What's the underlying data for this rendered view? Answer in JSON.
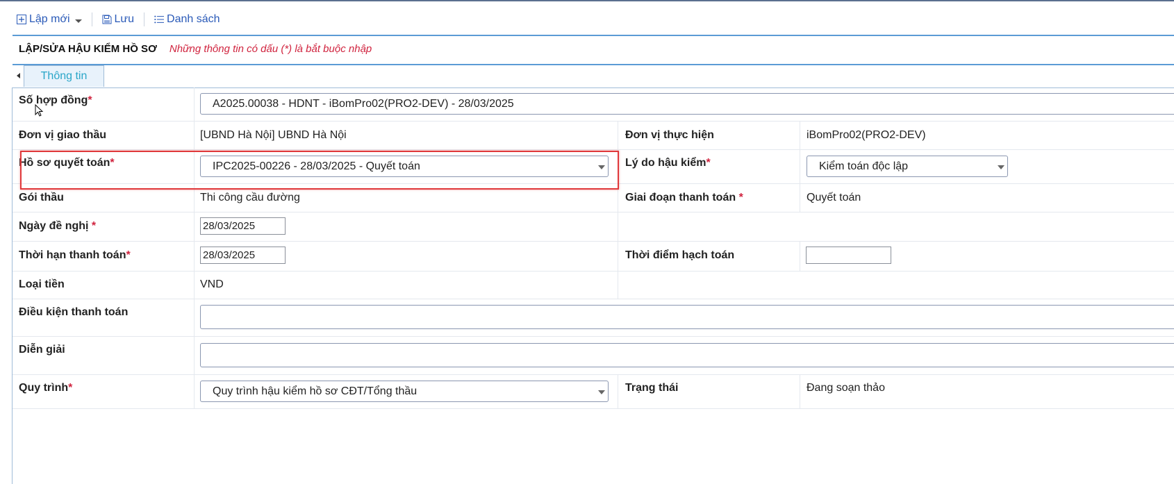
{
  "toolbar": {
    "new_label": "Lập mới",
    "save_label": "Lưu",
    "list_label": "Danh sách"
  },
  "header": {
    "title": "LẬP/SỬA HẬU KIỂM HỒ SƠ",
    "required_note": "Những thông tin có dấu (*) là bắt buộc nhập"
  },
  "tabs": [
    {
      "label": "Thông tin"
    }
  ],
  "form": {
    "contract_number": {
      "label": "Số hợp đồng",
      "required": "*",
      "value": "A2025.00038 - HDNT - iBomPro02(PRO2-DEV) - 28/03/2025"
    },
    "tendering_unit": {
      "label": "Đơn vị giao thầu",
      "value": "[UBND Hà Nội] UBND Hà Nội"
    },
    "executing_unit": {
      "label": "Đơn vị thực hiện",
      "value": "iBomPro02(PRO2-DEV)"
    },
    "settlement_file": {
      "label": "Hồ sơ quyết toán",
      "required": "*",
      "value": "IPC2025-00226 - 28/03/2025 - Quyết toán"
    },
    "audit_reason": {
      "label": "Lý do hậu kiểm",
      "required": "*",
      "value": "Kiểm toán độc lập"
    },
    "package": {
      "label": "Gói thầu",
      "value": "Thi công cầu đường"
    },
    "payment_stage": {
      "label": "Giai đoạn thanh toán",
      "required": "*",
      "value": "Quyết toán"
    },
    "request_date": {
      "label": "Ngày đề nghị",
      "required": "*",
      "value": "28/03/2025"
    },
    "payment_deadline": {
      "label": "Thời hạn thanh toán",
      "required": "*",
      "value": "28/03/2025"
    },
    "accounting_time": {
      "label": "Thời điểm hạch toán",
      "value": ""
    },
    "currency": {
      "label": "Loại tiền",
      "value": "VND"
    },
    "payment_terms": {
      "label": "Điều kiện thanh toán",
      "value": ""
    },
    "description": {
      "label": "Diễn giải",
      "value": ""
    },
    "workflow": {
      "label": "Quy trình",
      "required": "*",
      "value": "Quy trình hậu kiểm hồ sơ CĐT/Tổng thầu"
    },
    "status": {
      "label": "Trạng thái",
      "value": "Đang soạn thảo"
    }
  },
  "colors": {
    "accent": "#2a5ab8",
    "required": "#d0233e",
    "highlight": "#e0393b",
    "tab_text": "#2aa6c8"
  }
}
